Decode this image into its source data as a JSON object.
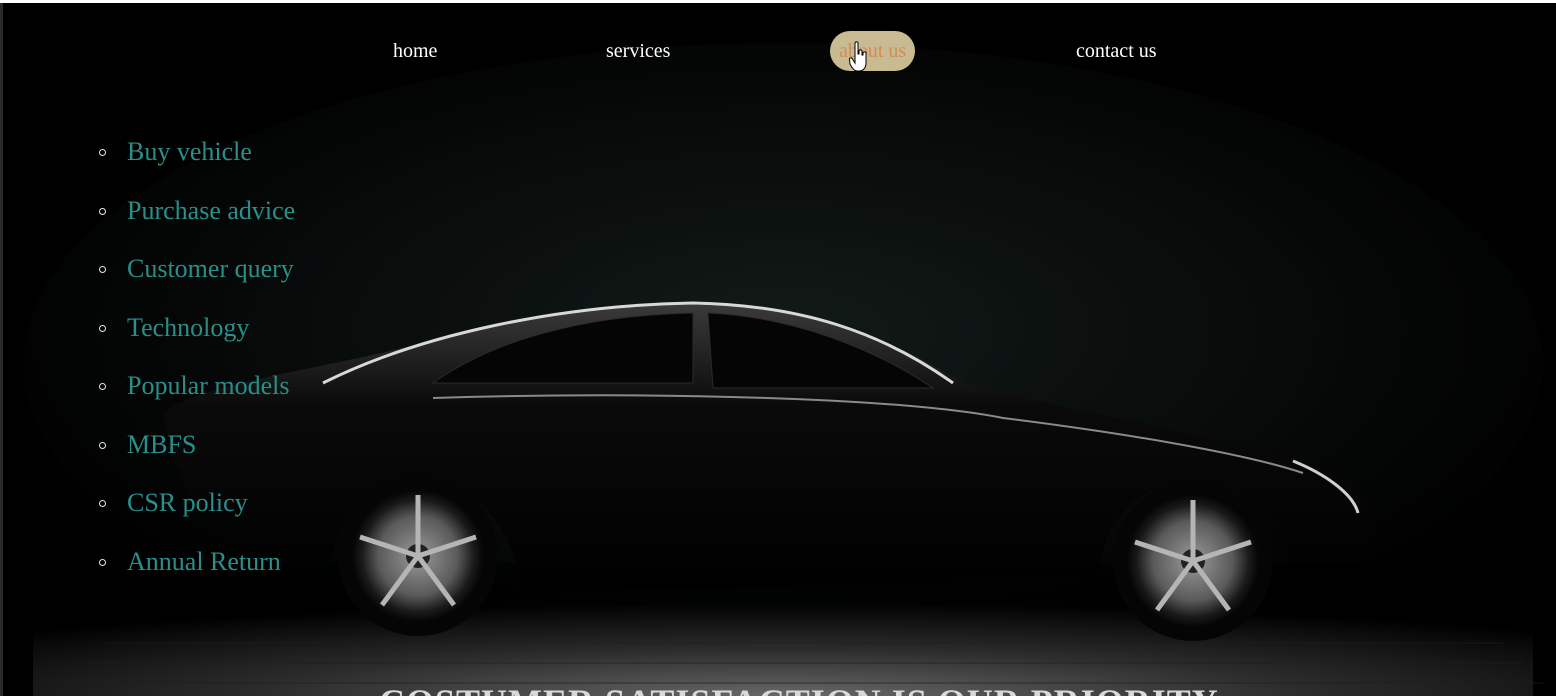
{
  "nav": {
    "home": "home",
    "services": "services",
    "about": "about us",
    "contact": "contact us"
  },
  "side_menu": {
    "items": [
      {
        "label": "Buy vehicle"
      },
      {
        "label": "Purchase advice"
      },
      {
        "label": "Customer query"
      },
      {
        "label": "Technology"
      },
      {
        "label": "Popular models"
      },
      {
        "label": "MBFS"
      },
      {
        "label": "CSR policy"
      },
      {
        "label": "Annual Return"
      }
    ]
  },
  "hero": {
    "image": "black-sedan-car-silhouette",
    "banner_text": "COSTUMER SATISFACTION IS OUR PRIORITY"
  },
  "colors": {
    "page_bg": "#000000",
    "nav_text": "#ffffff",
    "nav_hover_bg": "#c8bb92",
    "nav_hover_text": "#d28b57",
    "menu_text": "#2a8f8a"
  }
}
